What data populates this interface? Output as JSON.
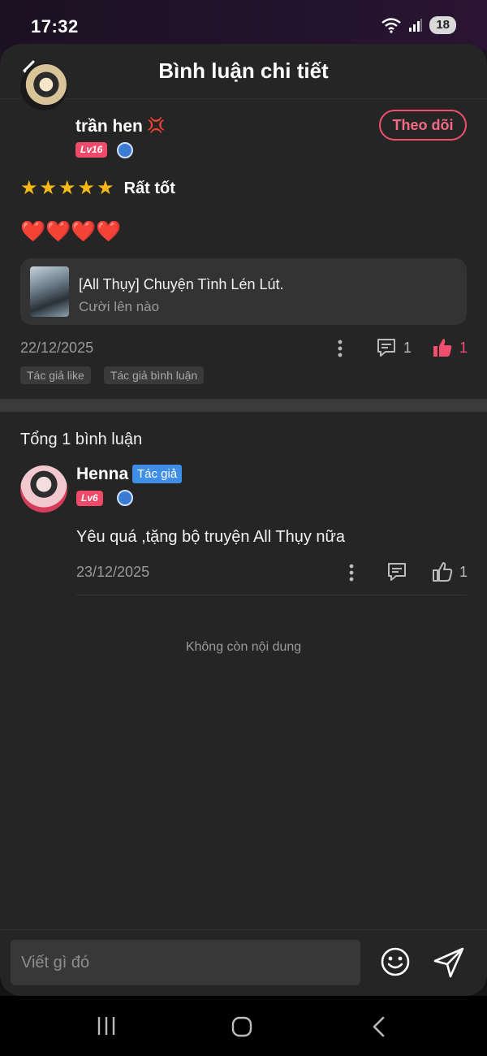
{
  "status_bar": {
    "time": "17:32",
    "battery": "18"
  },
  "header": {
    "title": "Bình luận chi tiết"
  },
  "review": {
    "user_name": "trần hen",
    "level": "Lv16",
    "follow_label": "Theo dõi",
    "rating_label": "Rất tốt",
    "stars": 5,
    "hearts": "❤️❤️❤️❤️",
    "book": {
      "title": "[All Thụy] Chuyện Tình Lén Lút.",
      "subtitle": "Cười lên nào"
    },
    "date": "22/12/2025",
    "comment_count": "1",
    "like_count": "1",
    "tags": [
      "Tác giả like",
      "Tác giả bình luận"
    ]
  },
  "comments_section": {
    "total_label": "Tổng 1 bình luận",
    "reply": {
      "user_name": "Henna",
      "author_badge": "Tác giả",
      "level": "Lv6",
      "text": "Yêu quá ,tặng bộ truyện All Thụy nữa",
      "date": "23/12/2025",
      "like_count": "1"
    },
    "end_text": "Không còn nội dung"
  },
  "input": {
    "placeholder": "Viết gì đó"
  },
  "colors": {
    "accent": "#f0506e",
    "author_blue": "#3f8fe8",
    "star": "#f6b817"
  }
}
